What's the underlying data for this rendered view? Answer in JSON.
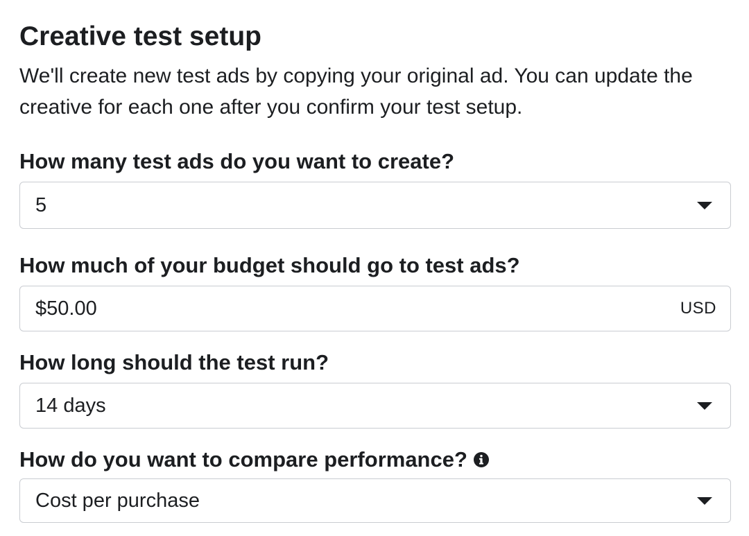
{
  "header": {
    "title": "Creative test setup",
    "description": "We'll create new test ads by copying your original ad. You can update the creative for each one after you confirm your test setup."
  },
  "fields": {
    "test_ad_count": {
      "label": "How many test ads do you want to create?",
      "value": "5",
      "icon": "chevron-down-icon"
    },
    "budget": {
      "label": "How much of your budget should go to test ads?",
      "value": "$50.00",
      "currency": "USD"
    },
    "duration": {
      "label": "How long should the test run?",
      "value": "14 days",
      "icon": "chevron-down-icon"
    },
    "comparison": {
      "label": "How do you want to compare performance?",
      "value": "Cost per purchase",
      "info_icon": "info-icon",
      "icon": "chevron-down-icon"
    }
  },
  "colors": {
    "text": "#1c1e21",
    "border": "#c9ccd1",
    "background": "#ffffff"
  }
}
